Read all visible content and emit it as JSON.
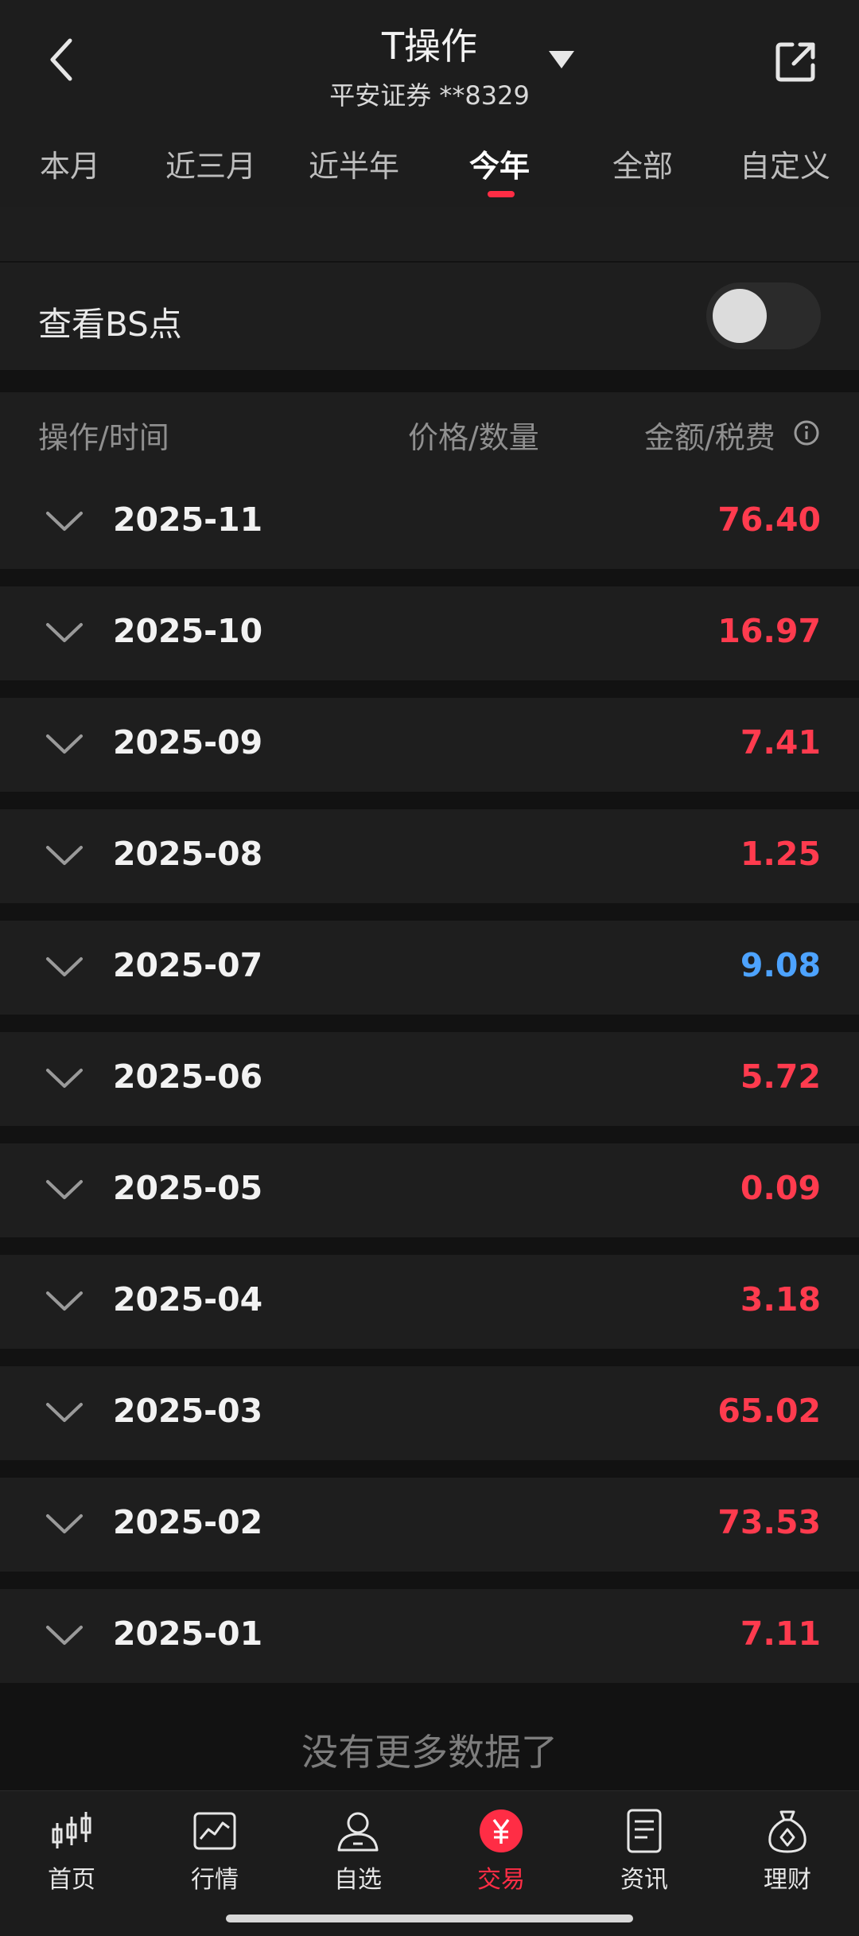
{
  "header": {
    "title": "T操作",
    "subtitle": "平安证券 **8329"
  },
  "tabs": [
    {
      "label": "本月"
    },
    {
      "label": "近三月"
    },
    {
      "label": "近半年"
    },
    {
      "label": "今年",
      "active": true
    },
    {
      "label": "全部"
    },
    {
      "label": "自定义"
    }
  ],
  "bs_toggle": {
    "label": "查看BS点",
    "on": false
  },
  "table": {
    "columns": [
      "操作/时间",
      "价格/数量",
      "金额/税费"
    ],
    "rows": [
      {
        "date": "2025-11",
        "amount": "76.40",
        "color": "#ff3b4e"
      },
      {
        "date": "2025-10",
        "amount": "16.97",
        "color": "#ff3b4e"
      },
      {
        "date": "2025-09",
        "amount": "7.41",
        "color": "#ff3b4e"
      },
      {
        "date": "2025-08",
        "amount": "1.25",
        "color": "#ff3b4e"
      },
      {
        "date": "2025-07",
        "amount": "9.08",
        "color": "#4da3ff"
      },
      {
        "date": "2025-06",
        "amount": "5.72",
        "color": "#ff3b4e"
      },
      {
        "date": "2025-05",
        "amount": "0.09",
        "color": "#ff3b4e"
      },
      {
        "date": "2025-04",
        "amount": "3.18",
        "color": "#ff3b4e"
      },
      {
        "date": "2025-03",
        "amount": "65.02",
        "color": "#ff3b4e"
      },
      {
        "date": "2025-02",
        "amount": "73.53",
        "color": "#ff3b4e"
      },
      {
        "date": "2025-01",
        "amount": "7.11",
        "color": "#ff3b4e"
      }
    ],
    "footer": "没有更多数据了"
  },
  "tabbar": [
    {
      "label": "首页",
      "icon": "candlestick-icon"
    },
    {
      "label": "行情",
      "icon": "chart-icon"
    },
    {
      "label": "自选",
      "icon": "person-icon"
    },
    {
      "label": "交易",
      "icon": "yen-coin-icon",
      "active": true
    },
    {
      "label": "资讯",
      "icon": "document-icon"
    },
    {
      "label": "理财",
      "icon": "money-bag-icon"
    }
  ],
  "colors": {
    "accent": "#ff2d45",
    "positive": "#ff3b4e",
    "negative": "#4da3ff"
  }
}
